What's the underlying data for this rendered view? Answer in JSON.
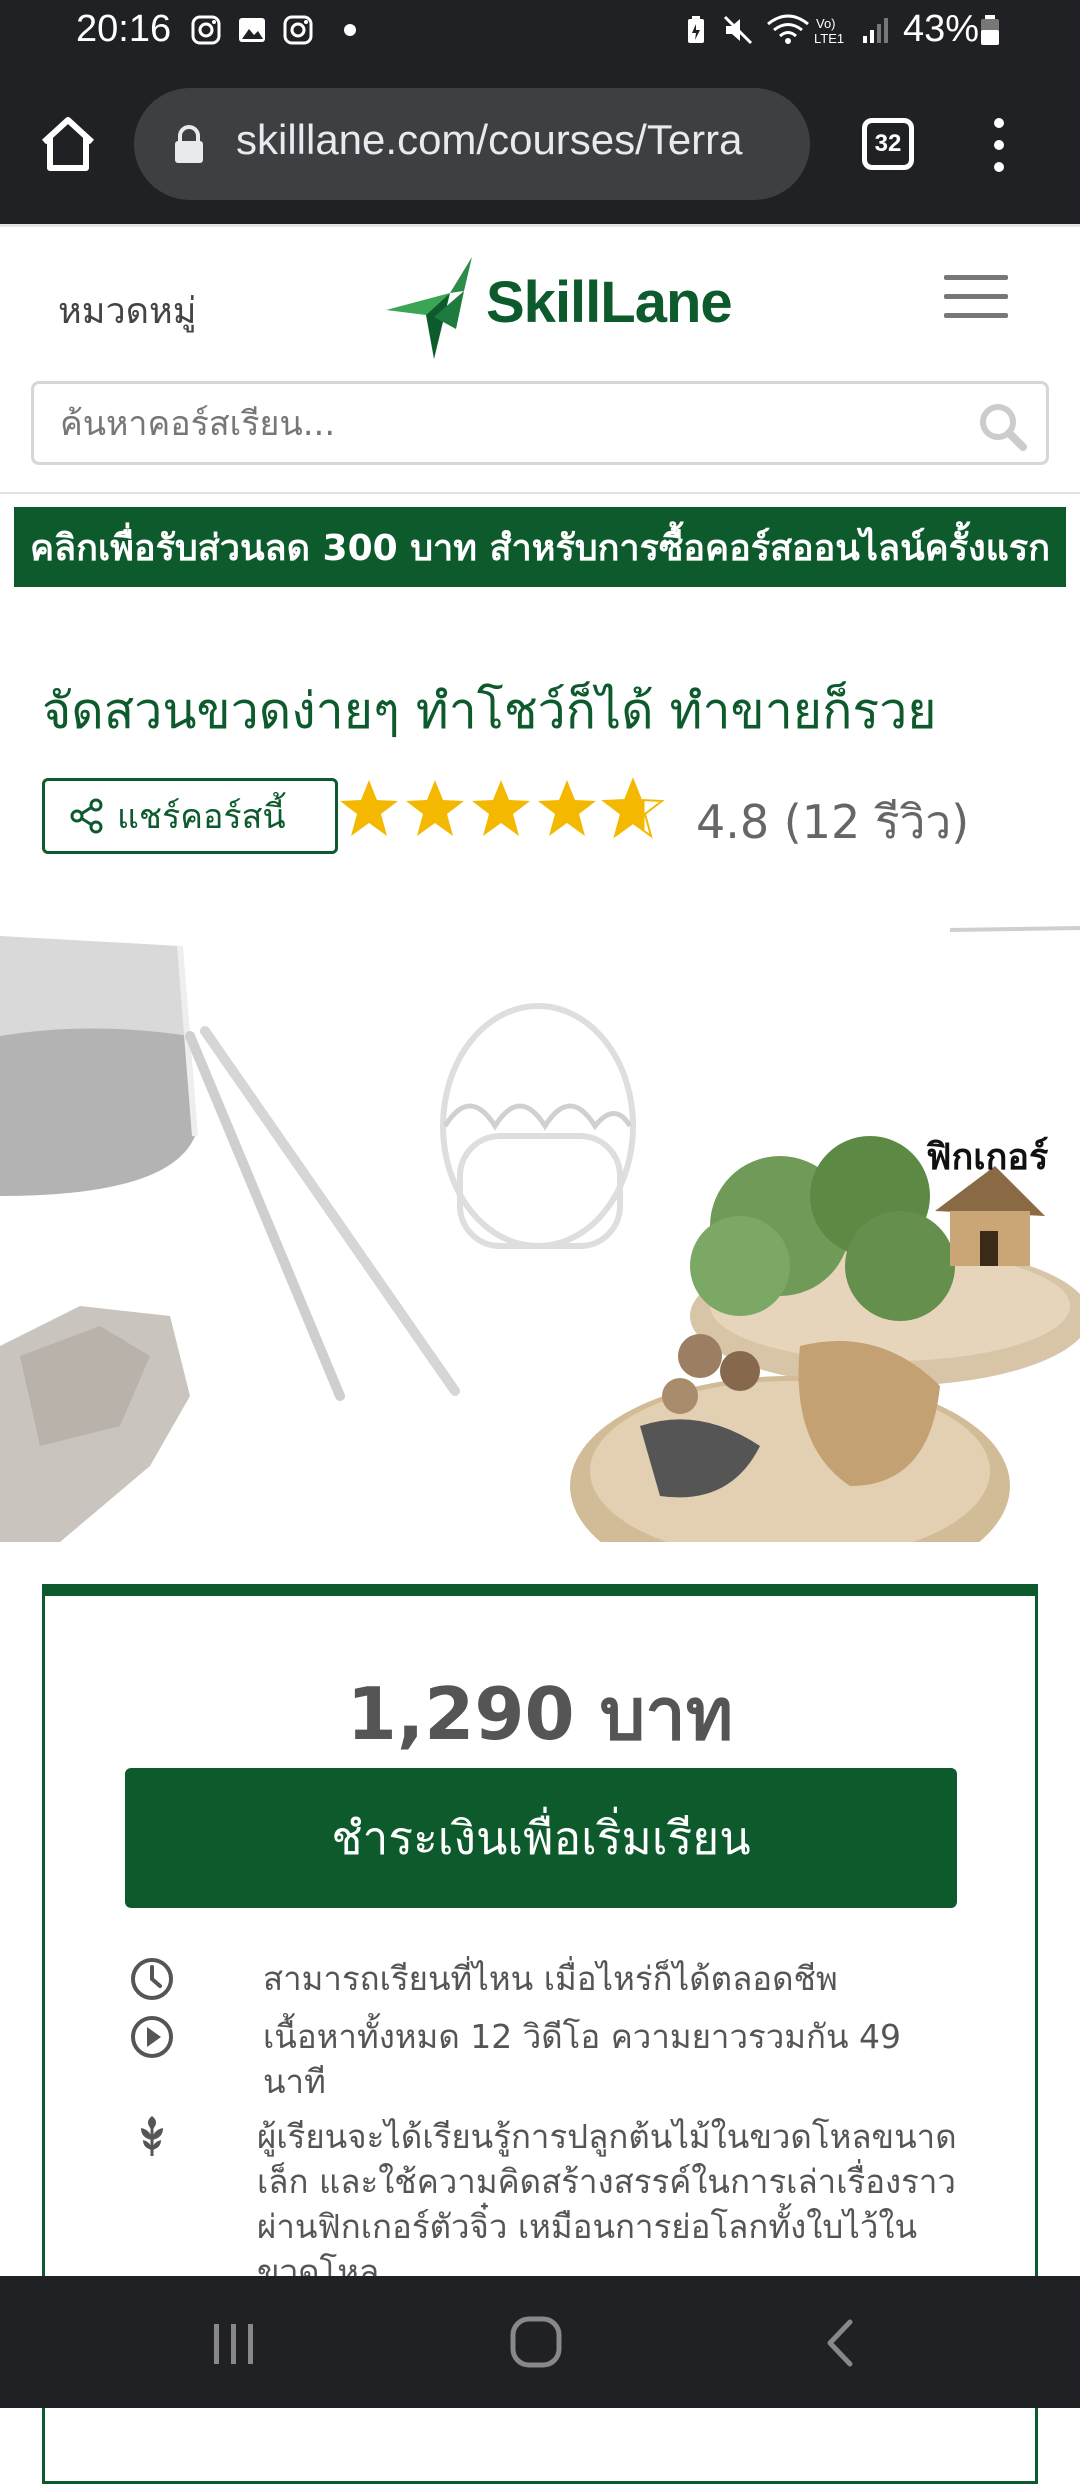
{
  "status_bar": {
    "time": "20:16",
    "battery": "43%",
    "icons": [
      "instagram-icon",
      "gallery-icon",
      "instagram-icon",
      "dot-icon",
      "battery-saver-icon",
      "mute-icon",
      "wifi-icon",
      "volte-icon",
      "signal-icon",
      "battery-icon"
    ]
  },
  "browser": {
    "url": "skilllane.com/courses/Terra",
    "tab_count": "32"
  },
  "header": {
    "categories_label": "หมวดหมู่",
    "logo_text": "SkillLane",
    "search_placeholder": "ค้นหาคอร์สเรียน..."
  },
  "promo": {
    "text": "คลิกเพื่อรับส่วนลด 300 บาท สำหรับการซื้อคอร์สออนไลน์ครั้งแรก"
  },
  "course": {
    "title": "จัดสวนขวดง่ายๆ ทำโชว์ก็ได้ ทำขายก็รวย",
    "share_label": "แชร์คอร์สนี้",
    "rating": 4.8,
    "rating_text": "4.8  (12  รีวิว)",
    "hero_label": "ฟิกเกอร์"
  },
  "price_card": {
    "price": "1,290  บาท",
    "buy_label": "ชำระเงินเพื่อเริ่มเรียน",
    "features": [
      {
        "icon": "clock-icon",
        "text": "สามารถเรียนที่ไหน  เมื่อไหร่ก็ได้ตลอดชีพ"
      },
      {
        "icon": "play-icon",
        "text": "เนื้อหาทั้งหมด  12  วิดีโอ  ความยาวรวมกัน  49  นาที"
      },
      {
        "icon": "plant-icon",
        "text": "ผู้เรียนจะได้เรียนรู้การปลูกต้นไม้ในขวดโหลขนาดเล็ก  และใช้ความคิดสร้างสรรค์ในการเล่าเรื่องราวผ่านฟิกเกอร์ตัวจิ๋ว  เหมือนการย่อโลกทั้งใบไว้ในขวดโหล"
      }
    ]
  },
  "colors": {
    "brand_green": "#0d5a2c",
    "star": "#f5b800",
    "system_bar": "#202124"
  }
}
